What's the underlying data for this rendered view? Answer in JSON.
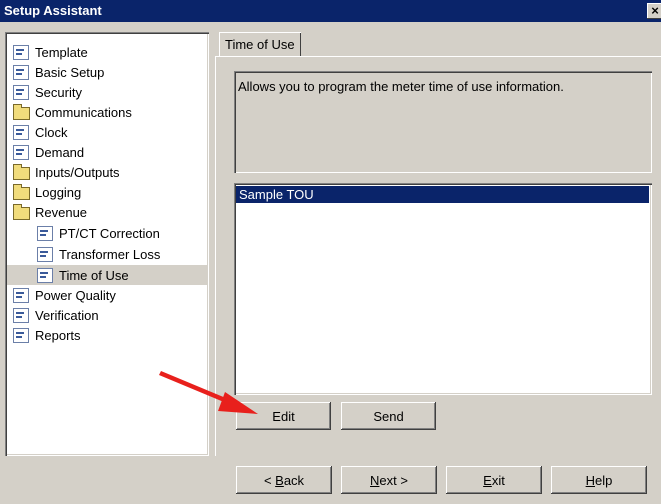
{
  "window": {
    "title": "Setup Assistant",
    "close_glyph": "×"
  },
  "tree": {
    "items": [
      {
        "label": "Template",
        "icon": "doc-icon"
      },
      {
        "label": "Basic Setup",
        "icon": "doc-icon"
      },
      {
        "label": "Security",
        "icon": "doc-icon"
      },
      {
        "label": "Communications",
        "icon": "folder-icon"
      },
      {
        "label": "Clock",
        "icon": "doc-icon"
      },
      {
        "label": "Demand",
        "icon": "doc-icon"
      },
      {
        "label": "Inputs/Outputs",
        "icon": "folder-icon"
      },
      {
        "label": "Logging",
        "icon": "folder-icon"
      },
      {
        "label": "Revenue",
        "icon": "folder-icon"
      },
      {
        "label": "PT/CT Correction",
        "icon": "doc-icon"
      },
      {
        "label": "Transformer Loss",
        "icon": "doc-icon"
      },
      {
        "label": "Time of Use",
        "icon": "doc-icon",
        "selected": true
      },
      {
        "label": "Power Quality",
        "icon": "doc-icon"
      },
      {
        "label": "Verification",
        "icon": "doc-icon"
      },
      {
        "label": "Reports",
        "icon": "doc-icon"
      }
    ]
  },
  "tab": {
    "label": "Time of Use"
  },
  "description": "Allows you to program the meter time of use information.",
  "list": {
    "rows": [
      "Sample TOU"
    ]
  },
  "buttons": {
    "edit": "Edit",
    "send": "Send"
  },
  "nav": {
    "back": {
      "prefix": "< ",
      "key": "B",
      "rest": "ack"
    },
    "next": {
      "key": "N",
      "rest": "ext >"
    },
    "exit": {
      "key": "E",
      "rest": "xit"
    },
    "help": {
      "key": "H",
      "rest": "elp"
    }
  },
  "colors": {
    "titlebar": "#0a246a",
    "selection": "#0a246a",
    "face": "#d4d0c8",
    "arrow": "#e8201c"
  }
}
